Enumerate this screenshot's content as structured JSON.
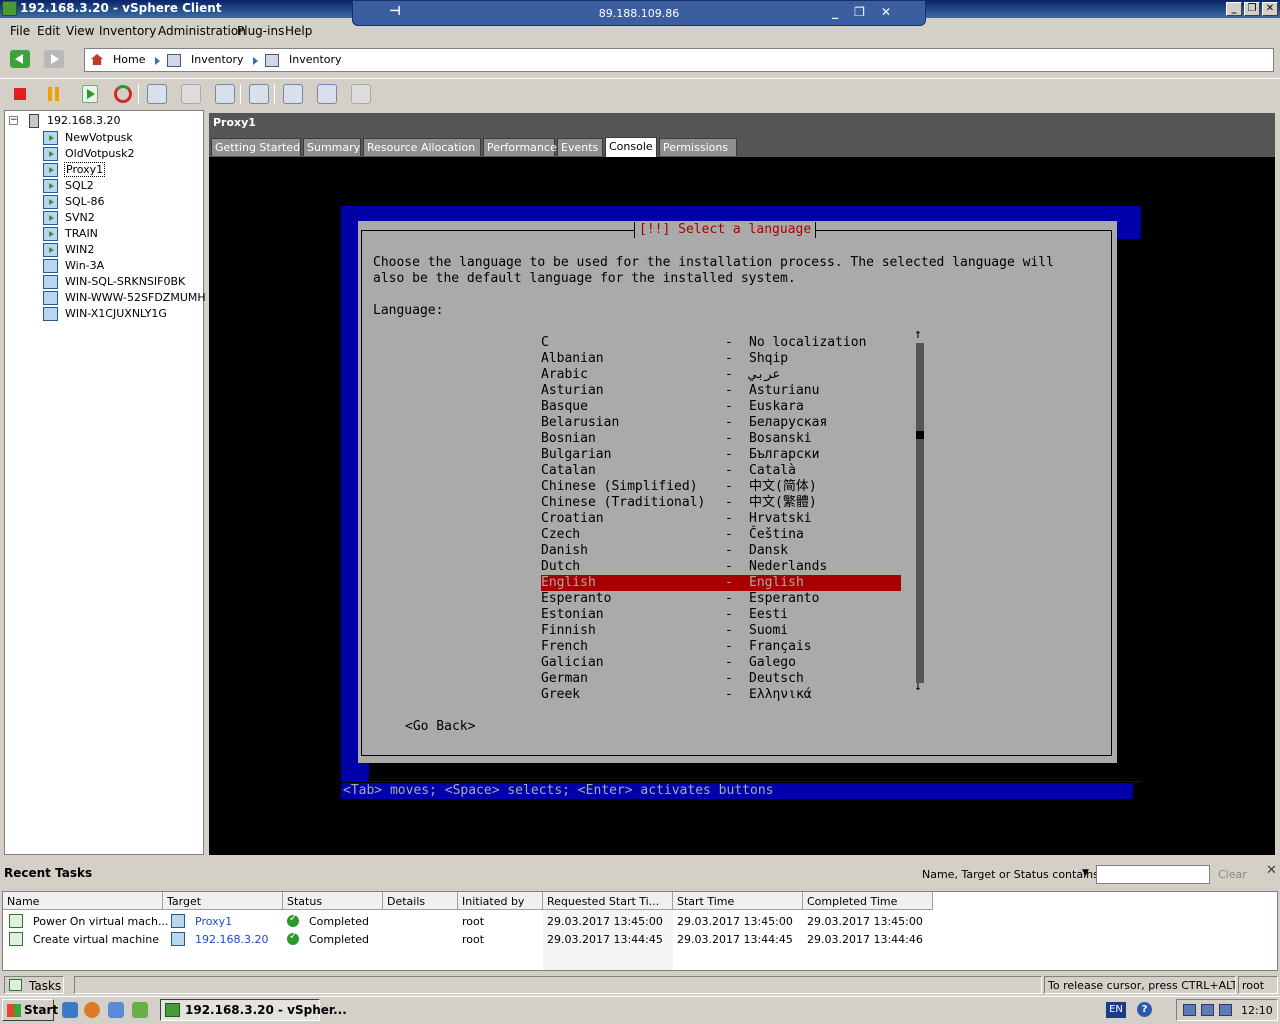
{
  "window": {
    "title": "192.168.3.20 - vSphere Client",
    "remote_address": "89.188.109.86"
  },
  "menu": {
    "items": [
      "File",
      "Edit",
      "View",
      "Inventory",
      "Administration",
      "Plug-ins",
      "Help"
    ]
  },
  "breadcrumb": {
    "home": "Home",
    "inventory1": "Inventory",
    "inventory2": "Inventory"
  },
  "tree": {
    "host": "192.168.3.20",
    "vms": [
      {
        "name": "NewVotpusk",
        "powered_on": true
      },
      {
        "name": "OldVotpusk2",
        "powered_on": true
      },
      {
        "name": "Proxy1",
        "powered_on": true
      },
      {
        "name": "SQL2",
        "powered_on": true
      },
      {
        "name": "SQL-86",
        "powered_on": true
      },
      {
        "name": "SVN2",
        "powered_on": true
      },
      {
        "name": "TRAIN",
        "powered_on": true
      },
      {
        "name": "WIN2",
        "powered_on": true
      },
      {
        "name": "Win-3A",
        "powered_on": false
      },
      {
        "name": "WIN-SQL-SRKNSIF0BK",
        "powered_on": false
      },
      {
        "name": "WIN-WWW-52SFDZMUMH",
        "powered_on": false
      },
      {
        "name": "WIN-X1CJUXNLY1G",
        "powered_on": false
      }
    ],
    "selected": "Proxy1"
  },
  "vm_panel": {
    "title": "Proxy1",
    "tabs": [
      "Getting Started",
      "Summary",
      "Resource Allocation",
      "Performance",
      "Events",
      "Console",
      "Permissions"
    ],
    "active_tab": "Console"
  },
  "installer": {
    "title": "[!!] Select a language",
    "prompt_line1": "Choose the language to be used for the installation process. The selected language will",
    "prompt_line2": "also be the default language for the installed system.",
    "language_label": "Language:",
    "languages": [
      {
        "name": "C",
        "native": "No localization"
      },
      {
        "name": "Albanian",
        "native": "Shqip"
      },
      {
        "name": "Arabic",
        "native": "عربي"
      },
      {
        "name": "Asturian",
        "native": "Asturianu"
      },
      {
        "name": "Basque",
        "native": "Euskara"
      },
      {
        "name": "Belarusian",
        "native": "Беларуская"
      },
      {
        "name": "Bosnian",
        "native": "Bosanski"
      },
      {
        "name": "Bulgarian",
        "native": "Български"
      },
      {
        "name": "Catalan",
        "native": "Català"
      },
      {
        "name": "Chinese (Simplified)",
        "native": "中文(简体)"
      },
      {
        "name": "Chinese (Traditional)",
        "native": "中文(繁體)"
      },
      {
        "name": "Croatian",
        "native": "Hrvatski"
      },
      {
        "name": "Czech",
        "native": "Čeština"
      },
      {
        "name": "Danish",
        "native": "Dansk"
      },
      {
        "name": "Dutch",
        "native": "Nederlands"
      },
      {
        "name": "English",
        "native": "English"
      },
      {
        "name": "Esperanto",
        "native": "Esperanto"
      },
      {
        "name": "Estonian",
        "native": "Eesti"
      },
      {
        "name": "Finnish",
        "native": "Suomi"
      },
      {
        "name": "French",
        "native": "Français"
      },
      {
        "name": "Galician",
        "native": "Galego"
      },
      {
        "name": "German",
        "native": "Deutsch"
      },
      {
        "name": "Greek",
        "native": "Ελληνικά"
      }
    ],
    "selected_language": "English",
    "separator": "-",
    "scroll_up": "↑",
    "scroll_down": "↓",
    "go_back": "<Go Back>",
    "help_line": "<Tab> moves; <Space> selects; <Enter> activates buttons"
  },
  "recent_tasks": {
    "title": "Recent Tasks",
    "filter_label": "Name, Target or Status contains:",
    "filter_value": "",
    "clear_label": "Clear",
    "columns": [
      "Name",
      "Target",
      "Status",
      "Details",
      "Initiated by",
      "Requested Start Ti...",
      "Start Time",
      "Completed Time"
    ],
    "rows": [
      {
        "name": "Power On virtual mach...",
        "target": "Proxy1",
        "status": "Completed",
        "details": "",
        "initiated_by": "root",
        "requested": "29.03.2017 13:45:00",
        "start": "29.03.2017 13:45:00",
        "completed": "29.03.2017 13:45:00"
      },
      {
        "name": "Create virtual machine",
        "target": "192.168.3.20",
        "status": "Completed",
        "details": "",
        "initiated_by": "root",
        "requested": "29.03.2017 13:44:45",
        "start": "29.03.2017 13:44:45",
        "completed": "29.03.2017 13:44:46"
      }
    ]
  },
  "statusbar": {
    "tasks_label": "Tasks",
    "cursor_hint": "To release cursor, press CTRL+ALT",
    "user": "root"
  },
  "taskbar": {
    "start_label": "Start",
    "app_label": "192.168.3.20 - vSpher...",
    "language": "EN",
    "clock": "12:10"
  },
  "colors": {
    "installer_blue": "#0000a8",
    "installer_gray": "#aaaaaa",
    "installer_red": "#a80000"
  }
}
